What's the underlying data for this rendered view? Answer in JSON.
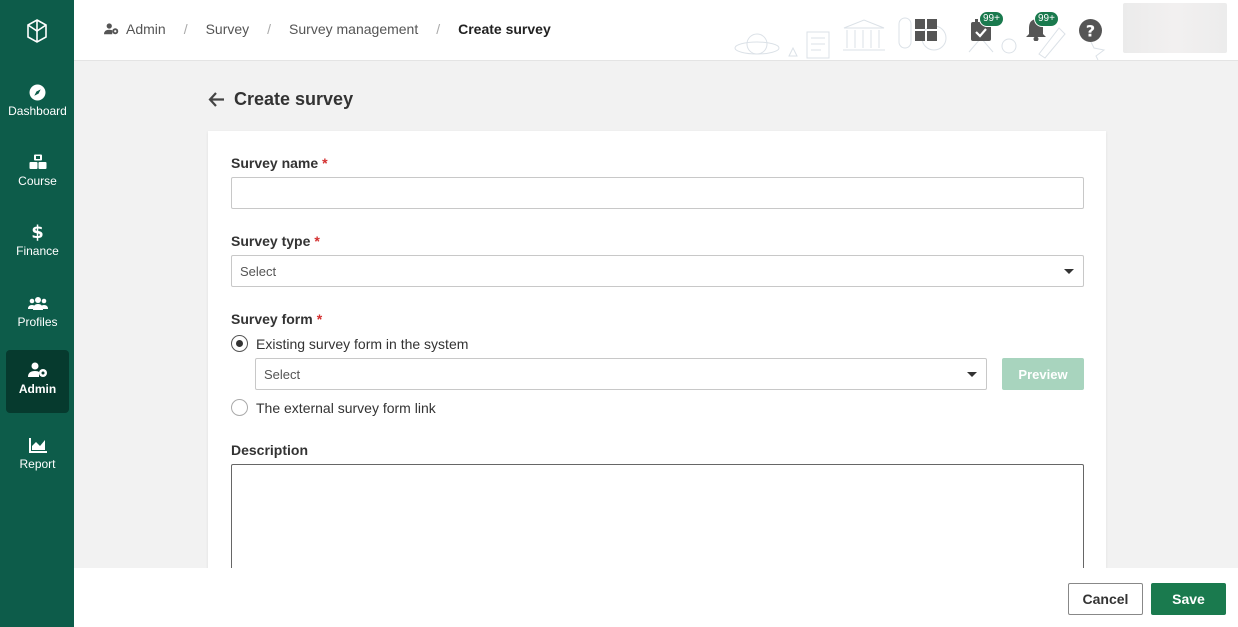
{
  "sidebar": {
    "items": [
      {
        "label": "Dashboard",
        "icon": "compass-icon"
      },
      {
        "label": "Course",
        "icon": "course-icon"
      },
      {
        "label": "Finance",
        "icon": "dollar-icon"
      },
      {
        "label": "Profiles",
        "icon": "users-icon"
      },
      {
        "label": "Admin",
        "icon": "user-gear-icon",
        "active": true
      },
      {
        "label": "Report",
        "icon": "chart-icon"
      }
    ]
  },
  "breadcrumb": {
    "items": [
      "Admin",
      "Survey",
      "Survey management"
    ],
    "current": "Create survey"
  },
  "header": {
    "tasks_badge": "99+",
    "notifications_badge": "99+"
  },
  "page": {
    "title": "Create survey"
  },
  "form": {
    "survey_name_label": "Survey name",
    "survey_name_value": "",
    "survey_type_label": "Survey type",
    "survey_type_value": "Select",
    "survey_form_label": "Survey form",
    "option_existing": "Existing survey form in the system",
    "existing_select_value": "Select",
    "preview_label": "Preview",
    "option_external": "The external survey form link",
    "description_label": "Description",
    "required_mark": "*"
  },
  "footer": {
    "cancel_label": "Cancel",
    "save_label": "Save"
  },
  "colors": {
    "sidebar": "#0d5c4a",
    "sidebar_active": "#063a2e",
    "primary": "#1a7a4e",
    "required": "#d32f2f"
  }
}
